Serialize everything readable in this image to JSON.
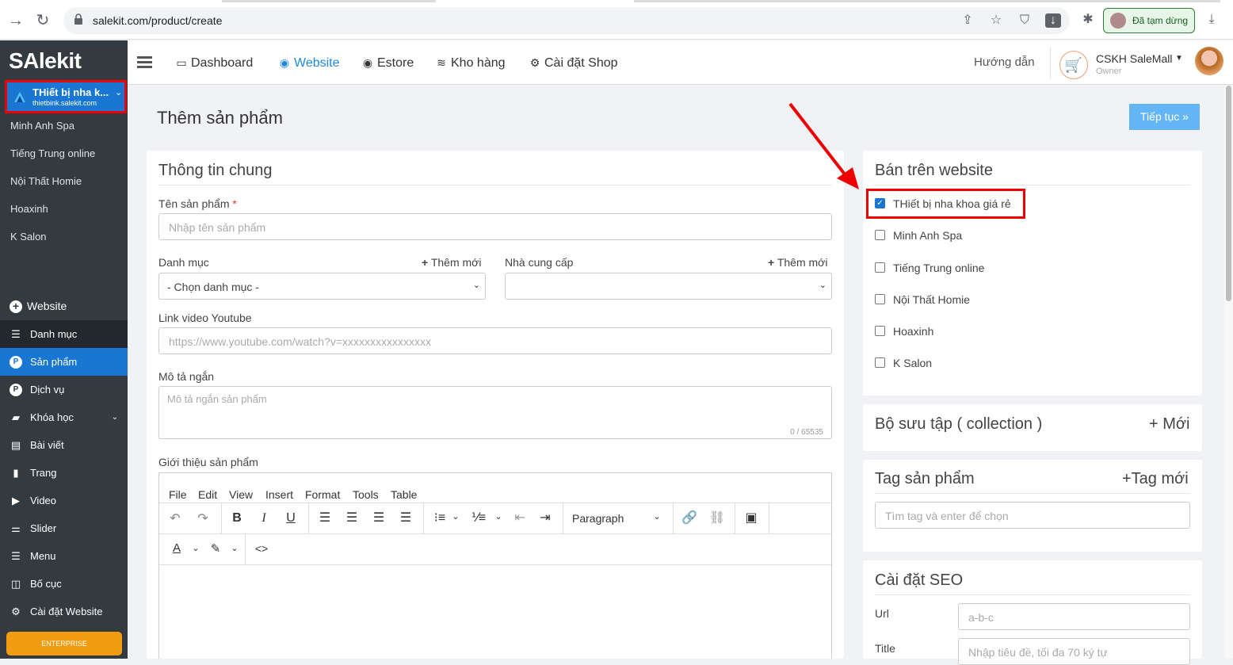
{
  "browser": {
    "url": "salekit.com/product/create",
    "profile_status": "Đã tạm dừng"
  },
  "sidebar": {
    "logo": "SAlekit",
    "store": {
      "name": "THiết bị nha k...",
      "domain": "thietbink.salekit.com"
    },
    "stores": [
      "Minh Anh Spa",
      "Tiếng Trung online",
      "Nội Thất Homie",
      "Hoaxinh",
      "K Salon"
    ],
    "website_label": "Website",
    "items": [
      {
        "label": "Danh mục",
        "icon": "list-icon"
      },
      {
        "label": "Sản phẩm",
        "icon": "product-icon"
      },
      {
        "label": "Dịch vụ",
        "icon": "service-icon"
      },
      {
        "label": "Khóa học",
        "icon": "book-icon"
      },
      {
        "label": "Bài viết",
        "icon": "newspaper-icon"
      },
      {
        "label": "Trang",
        "icon": "file-icon"
      },
      {
        "label": "Video",
        "icon": "video-icon"
      },
      {
        "label": "Slider",
        "icon": "sliders-icon"
      },
      {
        "label": "Menu",
        "icon": "menu-icon"
      },
      {
        "label": "Bố cục",
        "icon": "layout-icon"
      },
      {
        "label": "Cài đặt Website",
        "icon": "gear-icon"
      }
    ],
    "enterprise_label": "ENTERPRISE"
  },
  "topbar": {
    "nav": [
      "Dashboard",
      "Website",
      "Estore",
      "Kho hàng",
      "Cài đặt Shop"
    ],
    "guide": "Hướng dẫn",
    "account_name": "CSKH SaleMall",
    "account_role": "Owner"
  },
  "page": {
    "title": "Thêm sản phẩm",
    "continue_button": "Tiếp tục »"
  },
  "general": {
    "title": "Thông tin chung",
    "name_label": "Tên sản phẩm",
    "required_mark": "*",
    "name_placeholder": "Nhập tên sản phẩm",
    "category_label": "Danh mục",
    "category_add": "Thêm mới",
    "category_value": "- Chọn danh mục -",
    "supplier_label": "Nhà cung cấp",
    "supplier_add": "Thêm mới",
    "youtube_label": "Link video Youtube",
    "youtube_placeholder": "https://www.youtube.com/watch?v=xxxxxxxxxxxxxxxx",
    "short_desc_label": "Mô tả ngắn",
    "short_desc_placeholder": "Mô tả ngắn sản phẩm",
    "short_desc_counter": "0 / 65535",
    "intro_label": "Giới thiệu sản phẩm"
  },
  "editor": {
    "menus": [
      "File",
      "Edit",
      "View",
      "Insert",
      "Format",
      "Tools",
      "Table"
    ],
    "block_format": "Paragraph"
  },
  "website_panel": {
    "title": "Bán trên website",
    "sites": [
      {
        "label": "THiết bị nha khoa giá rẻ",
        "checked": true
      },
      {
        "label": "Minh Anh Spa",
        "checked": false
      },
      {
        "label": "Tiếng Trung online",
        "checked": false
      },
      {
        "label": "Nội Thất Homie",
        "checked": false
      },
      {
        "label": "Hoaxinh",
        "checked": false
      },
      {
        "label": "K Salon",
        "checked": false
      }
    ]
  },
  "collection": {
    "title": "Bộ sưu tập ( collection )",
    "add": "+ Mới"
  },
  "tags": {
    "title": "Tag sản phẩm",
    "add": "+Tag mới",
    "placeholder": "Tìm tag và enter để chọn"
  },
  "seo": {
    "title": "Cài đặt SEO",
    "url_label": "Url",
    "url_placeholder": "a-b-c",
    "title_label": "Title",
    "title_placeholder": "Nhập tiêu đề, tối đa 70 ký tự"
  },
  "colors": {
    "accent": "#1976d2",
    "sidebar": "#333a40",
    "highlight": "#e00000",
    "button": "#64b5f6"
  }
}
